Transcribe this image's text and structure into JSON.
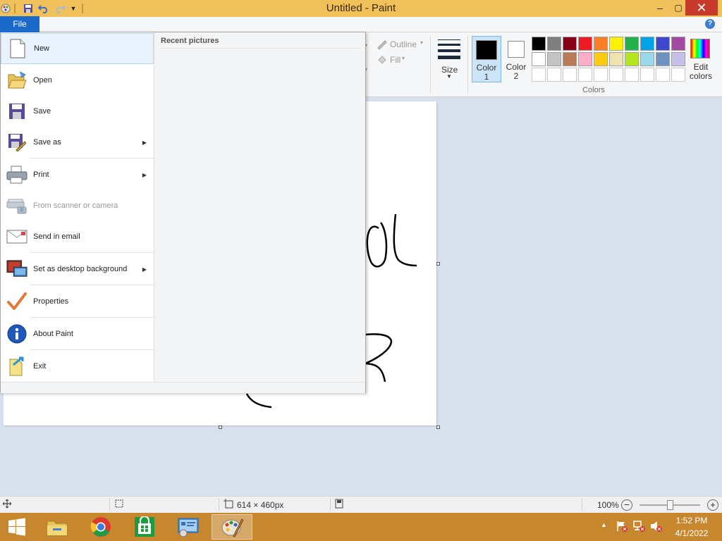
{
  "window": {
    "title": "Untitled - Paint",
    "accent": "#f0c05a",
    "controls": {
      "minimize": "–",
      "maximize": "▢",
      "close": "✕"
    }
  },
  "quick_access": {
    "save_icon": "save-icon",
    "undo_icon": "undo-icon",
    "redo_icon": "redo-icon",
    "customize_icon": "customize-arrow-icon"
  },
  "ribbon": {
    "file_tab": "File",
    "outline_label": "Outline",
    "fill_label": "Fill",
    "size_label": "Size",
    "color1_label": "Color\n1",
    "color2_label": "Color\n2",
    "colors_group_label": "Colors",
    "edit_colors_label": "Edit\ncolors",
    "palette": [
      "#000000",
      "#7f7f7f",
      "#880015",
      "#ed1c24",
      "#ff7f27",
      "#fff200",
      "#22b14c",
      "#00a2e8",
      "#3f48cc",
      "#a349a4",
      "#ffffff",
      "#c3c3c3",
      "#b97a57",
      "#ffaec9",
      "#ffc90e",
      "#efe4b0",
      "#b5e61d",
      "#99d9ea",
      "#7092be",
      "#c8bfe7",
      "#ffffff",
      "#ffffff",
      "#ffffff",
      "#ffffff",
      "#ffffff",
      "#ffffff",
      "#ffffff",
      "#ffffff",
      "#ffffff",
      "#ffffff"
    ]
  },
  "file_menu": {
    "items": [
      {
        "label": "New",
        "icon": "new-document-icon",
        "submenu": false,
        "selected": true,
        "disabled": false
      },
      {
        "label": "Open",
        "icon": "open-folder-icon",
        "submenu": false,
        "selected": false,
        "disabled": false
      },
      {
        "label": "Save",
        "icon": "save-disk-icon",
        "submenu": false,
        "selected": false,
        "disabled": false
      },
      {
        "label": "Save as",
        "icon": "save-as-icon",
        "submenu": true,
        "selected": false,
        "disabled": false
      },
      {
        "label": "Print",
        "icon": "printer-icon",
        "submenu": true,
        "selected": false,
        "disabled": false
      },
      {
        "label": "From scanner or camera",
        "icon": "scanner-icon",
        "submenu": false,
        "selected": false,
        "disabled": true
      },
      {
        "label": "Send in email",
        "icon": "email-icon",
        "submenu": false,
        "selected": false,
        "disabled": false
      },
      {
        "label": "Set as desktop background",
        "icon": "desktop-background-icon",
        "submenu": true,
        "selected": false,
        "disabled": false
      },
      {
        "label": "Properties",
        "icon": "properties-check-icon",
        "submenu": false,
        "selected": false,
        "disabled": false
      },
      {
        "label": "About Paint",
        "icon": "info-icon",
        "submenu": false,
        "selected": false,
        "disabled": false
      },
      {
        "label": "Exit",
        "icon": "exit-icon",
        "submenu": false,
        "selected": false,
        "disabled": false
      }
    ],
    "recent_title": "Recent pictures"
  },
  "status_bar": {
    "canvas_size": "614 × 460px",
    "zoom": "100%",
    "zoom_out": "−",
    "zoom_in": "+",
    "zoom_level": 1.0
  },
  "taskbar": {
    "apps": [
      "file-explorer-icon",
      "chrome-icon",
      "store-icon",
      "control-panel-icon",
      "paint-icon"
    ],
    "time": "1:52 PM",
    "date": "4/1/2022"
  }
}
